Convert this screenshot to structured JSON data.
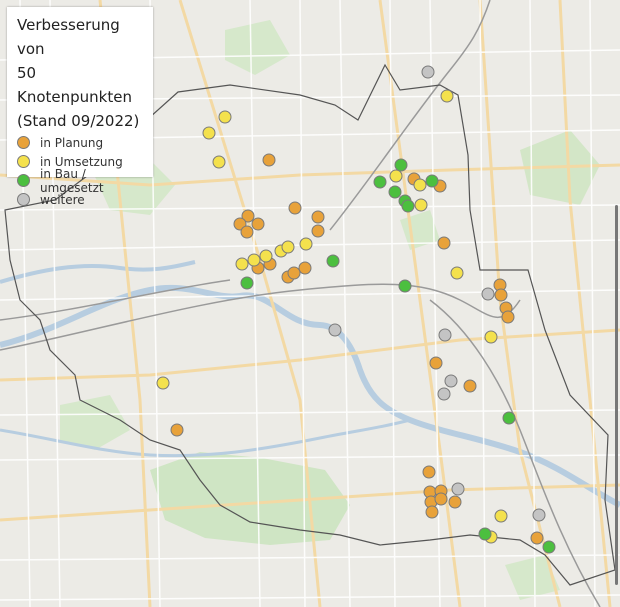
{
  "legend": {
    "title_lines": [
      "Verbesserung von",
      "50 Knotenpunkten",
      "(Stand 09/2022)"
    ],
    "items": [
      {
        "label": "in Planung",
        "color": "#e8a23a"
      },
      {
        "label": "in Umsetzung",
        "color": "#f4e14d"
      },
      {
        "label": "in Bau / umgesetzt",
        "color": "#4cbf3f"
      },
      {
        "label": "weitere",
        "color": "#c4c4c4"
      }
    ]
  }
}
